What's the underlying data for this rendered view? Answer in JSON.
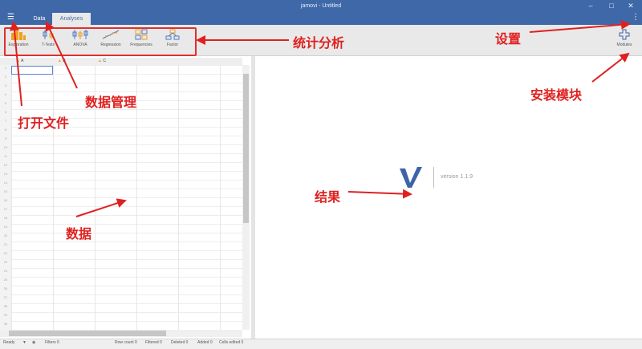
{
  "window": {
    "title": "jamovi - Untitled",
    "minimize": "–",
    "maximize": "□",
    "close": "✕"
  },
  "menu": {
    "hamburger_icon": "☰",
    "kebab_icon": "⋮"
  },
  "tabs": [
    {
      "label": "Data"
    },
    {
      "label": "Analyses"
    }
  ],
  "ribbon": {
    "items": [
      {
        "label": "Exploration"
      },
      {
        "label": "T-Tests"
      },
      {
        "label": "ANOVA"
      },
      {
        "label": "Regression"
      },
      {
        "label": "Frequencies"
      },
      {
        "label": "Factor"
      }
    ],
    "modules_label": "Modules"
  },
  "spreadsheet": {
    "columns": [
      "A",
      "B",
      "C"
    ],
    "rows": [
      "1",
      "2",
      "3",
      "4",
      "5",
      "6",
      "7",
      "8",
      "9",
      "10",
      "11",
      "12",
      "13",
      "14",
      "15",
      "16",
      "17",
      "18",
      "19",
      "20",
      "21",
      "22",
      "23",
      "24",
      "25",
      "26",
      "27",
      "28",
      "29",
      "30"
    ]
  },
  "results": {
    "version": "version 1.1.9"
  },
  "status": {
    "ready": "Ready",
    "filters": "Filters 0",
    "row_count": "Row count 0",
    "filtered": "Filtered 0",
    "deleted": "Deleted 0",
    "added": "Added 0",
    "cells_edited": "Cells edited 0"
  },
  "annotations": {
    "settings": "设置",
    "analysis": "统计分析",
    "install_modules": "安装模块",
    "data_management": "数据管理",
    "open_file": "打开文件",
    "results": "结果",
    "data": "数据"
  },
  "colors": {
    "titlebar": "#3f68a8",
    "accent": "#3d64a7",
    "annotation": "#e02020"
  }
}
